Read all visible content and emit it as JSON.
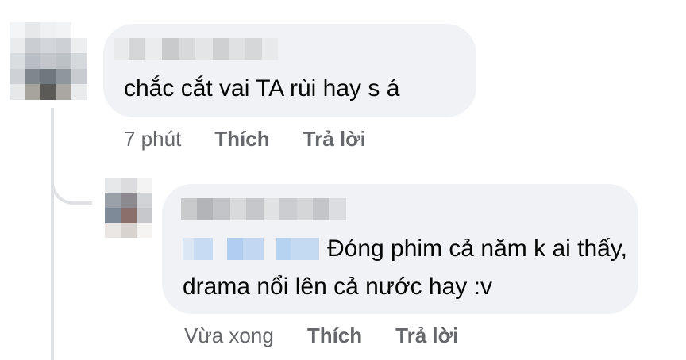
{
  "comment": {
    "text": "chắc cắt vai TA rùi hay s á",
    "time": "7 phút",
    "like_label": "Thích",
    "reply_label": "Trả lời"
  },
  "reply": {
    "text": "Đóng phim cả năm k ai thấy, drama nổi lên cả nước hay :v",
    "time": "Vừa xong",
    "like_label": "Thích",
    "reply_label": "Trả lời"
  },
  "colors": {
    "bubble": "#f0f2f5",
    "text": "#050505",
    "meta": "#65676b",
    "tag_blur": "#b7d3f2"
  }
}
